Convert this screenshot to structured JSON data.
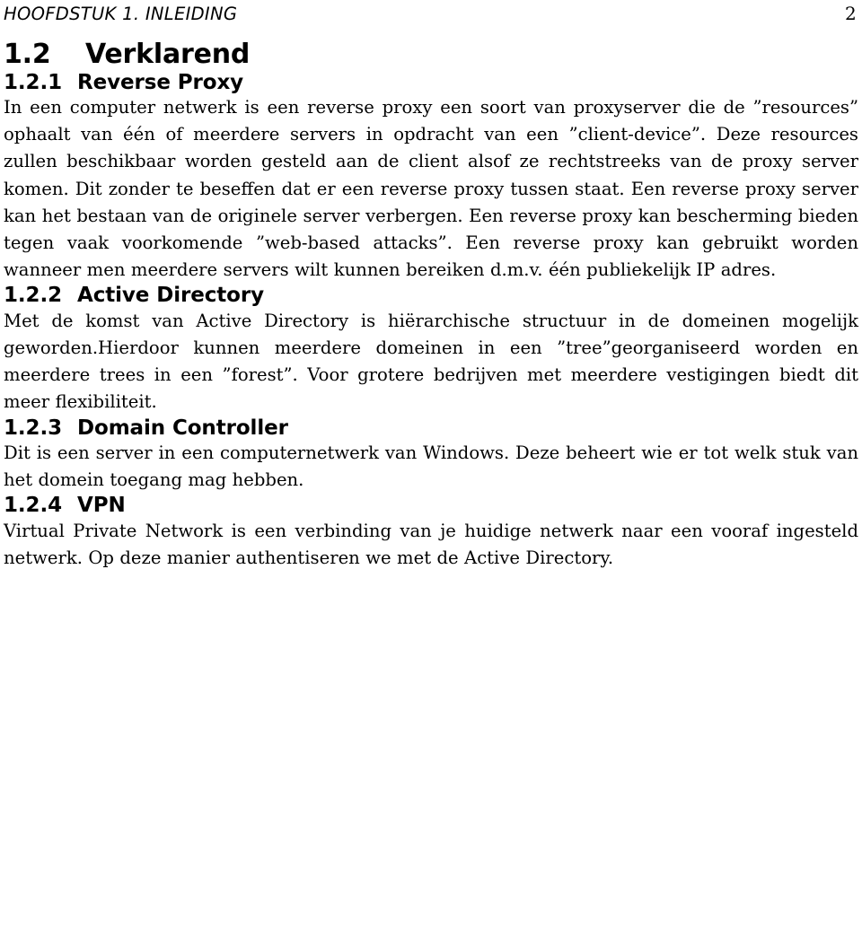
{
  "header": {
    "chapter_ref": "HOOFDSTUK 1.  INLEIDING",
    "page_number": "2"
  },
  "section": {
    "number": "1.2",
    "title": "Verklarend"
  },
  "subsections": [
    {
      "number": "1.2.1",
      "title": "Reverse Proxy",
      "paragraph": "In een computer netwerk is een reverse proxy een soort van proxyserver die de ”resources” ophaalt van één of meerdere servers in opdracht van een ”client-device”. Deze resources zullen beschikbaar worden gesteld aan de client alsof ze rechtstreeks van de proxy server komen. Dit zonder te beseffen dat er een reverse proxy tussen staat. Een reverse proxy server kan het bestaan van de originele server verbergen. Een reverse proxy kan bescherming bieden tegen vaak voorkomende ”web-based attacks”. Een reverse proxy kan gebruikt worden wanneer men meerdere servers wilt kunnen bereiken d.m.v. één publiekelijk IP adres."
    },
    {
      "number": "1.2.2",
      "title": "Active Directory",
      "paragraph": "Met de komst van Active Directory is hiërarchische structuur in de domeinen mogelijk geworden.Hierdoor kunnen meerdere domeinen in een ”tree”georganiseerd worden en meerdere trees in een ”forest”. Voor grotere bedrijven met meerdere vestigingen biedt dit meer flexibiliteit."
    },
    {
      "number": "1.2.3",
      "title": "Domain Controller",
      "paragraph": "Dit is een server in een computernetwerk van Windows. Deze beheert wie er tot welk stuk van het domein toegang mag hebben."
    },
    {
      "number": "1.2.4",
      "title": "VPN",
      "paragraph": "Virtual Private Network is een verbinding van je huidige netwerk naar een vooraf ingesteld netwerk. Op deze manier authentiseren we met de Active Directory."
    }
  ]
}
